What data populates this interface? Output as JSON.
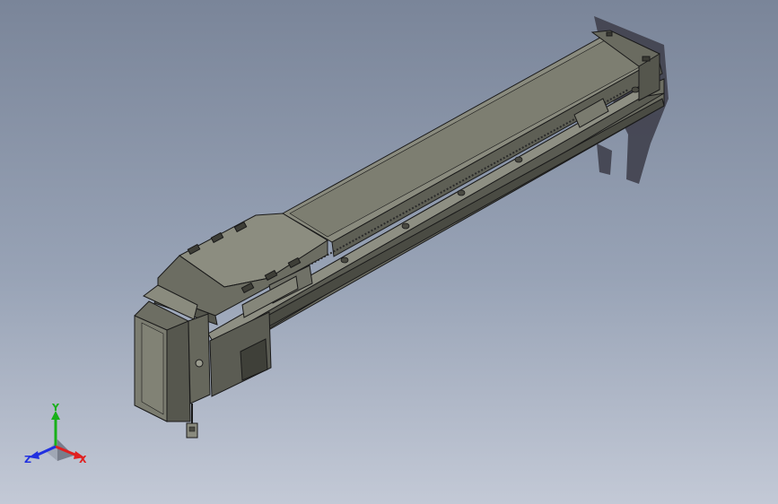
{
  "view": {
    "background_top": "#7a8599",
    "background_bottom": "#c3c9d6",
    "model_color": "#7c7d70",
    "edge_color": "#1a1a1a",
    "shadow_color": "#3a3a44"
  },
  "triad": {
    "x_label": "X",
    "y_label": "Y",
    "z_label": "Z",
    "x_color": "#e02020",
    "y_color": "#18b018",
    "z_color": "#2030e0"
  }
}
